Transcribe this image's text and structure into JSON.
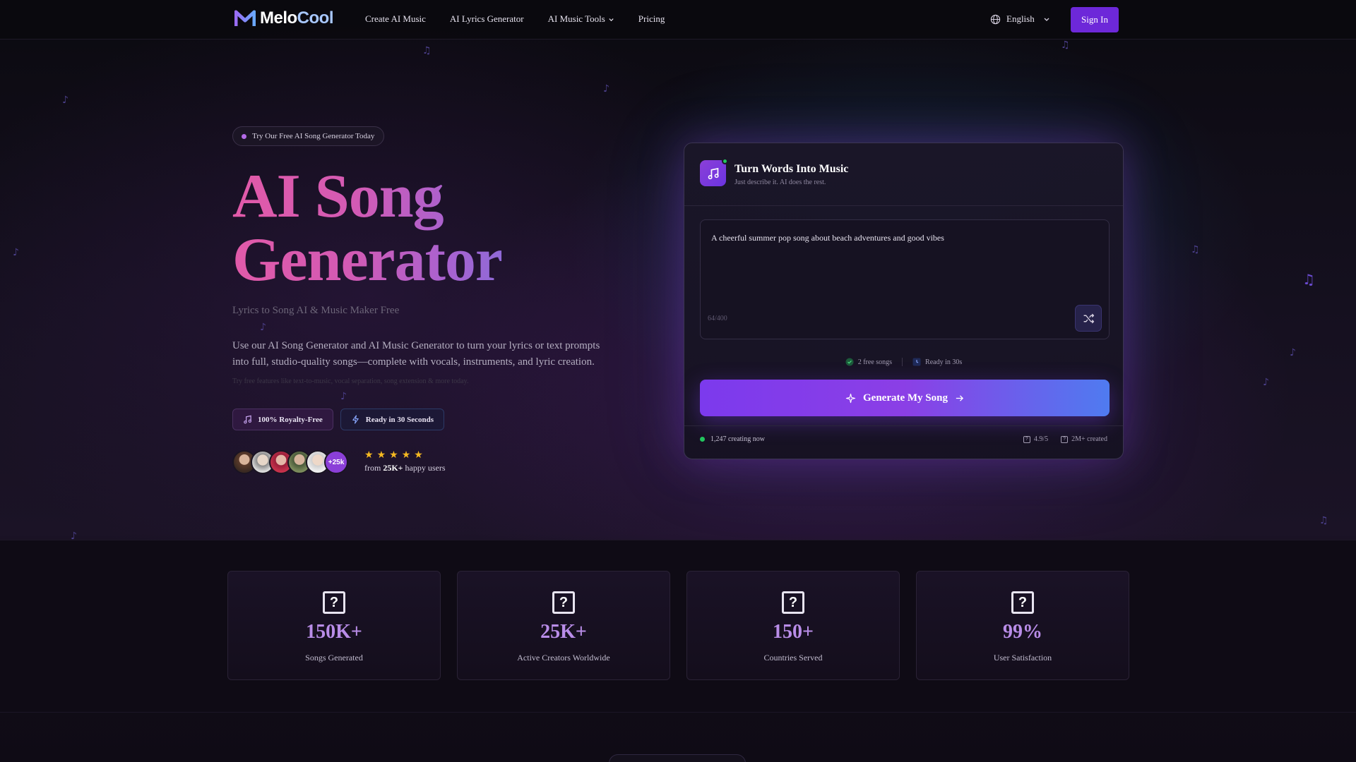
{
  "brand": {
    "name_part1": "Melo",
    "name_part2": "Cool"
  },
  "nav": {
    "links": [
      "Create AI Music",
      "AI Lyrics Generator",
      "AI Music Tools",
      "Pricing"
    ],
    "language": "English",
    "signin_label": "Sign In"
  },
  "hero": {
    "pill": "Try Our Free AI Song Generator Today",
    "title_line1": "AI Song",
    "title_line2": "Generator",
    "subtitle": "Lyrics to Song AI & Music Maker Free",
    "description": "Use our AI Song Generator and AI Music Generator to turn your lyrics or text prompts into full, studio-quality songs—complete with vocals, instruments, and lyric creation.",
    "tiny_note": "Try free features like text-to-music, vocal separation, song extension & more today.",
    "badges": [
      "100% Royalty-Free",
      "Ready in 30 Seconds"
    ],
    "avatar_more": "+25k",
    "rating": 5,
    "happy_prefix": "from ",
    "happy_count": "25K+",
    "happy_suffix": " happy users"
  },
  "card": {
    "title": "Turn Words Into Music",
    "subtitle": "Just describe it. AI does the rest.",
    "prompt_value": "A cheerful summer pop song about beach adventures and good vibes",
    "char_count": "64/400",
    "free_songs": "2 free songs",
    "ready": "Ready in 30s",
    "generate_label": "Generate My Song",
    "live": "1,247 creating now",
    "rating": "4.9/5",
    "created": "2M+ created"
  },
  "stats": [
    {
      "value": "150K+",
      "label": "Songs Generated"
    },
    {
      "value": "25K+",
      "label": "Active Creators Worldwide"
    },
    {
      "value": "150+",
      "label": "Countries Served"
    },
    {
      "value": "99%",
      "label": "User Satisfaction"
    }
  ],
  "colors": {
    "accent": "#7c3aed",
    "title_pink": "#e25aa8",
    "stat_purple": "#b98de8",
    "online": "#22c55e",
    "star": "#f5b921"
  }
}
